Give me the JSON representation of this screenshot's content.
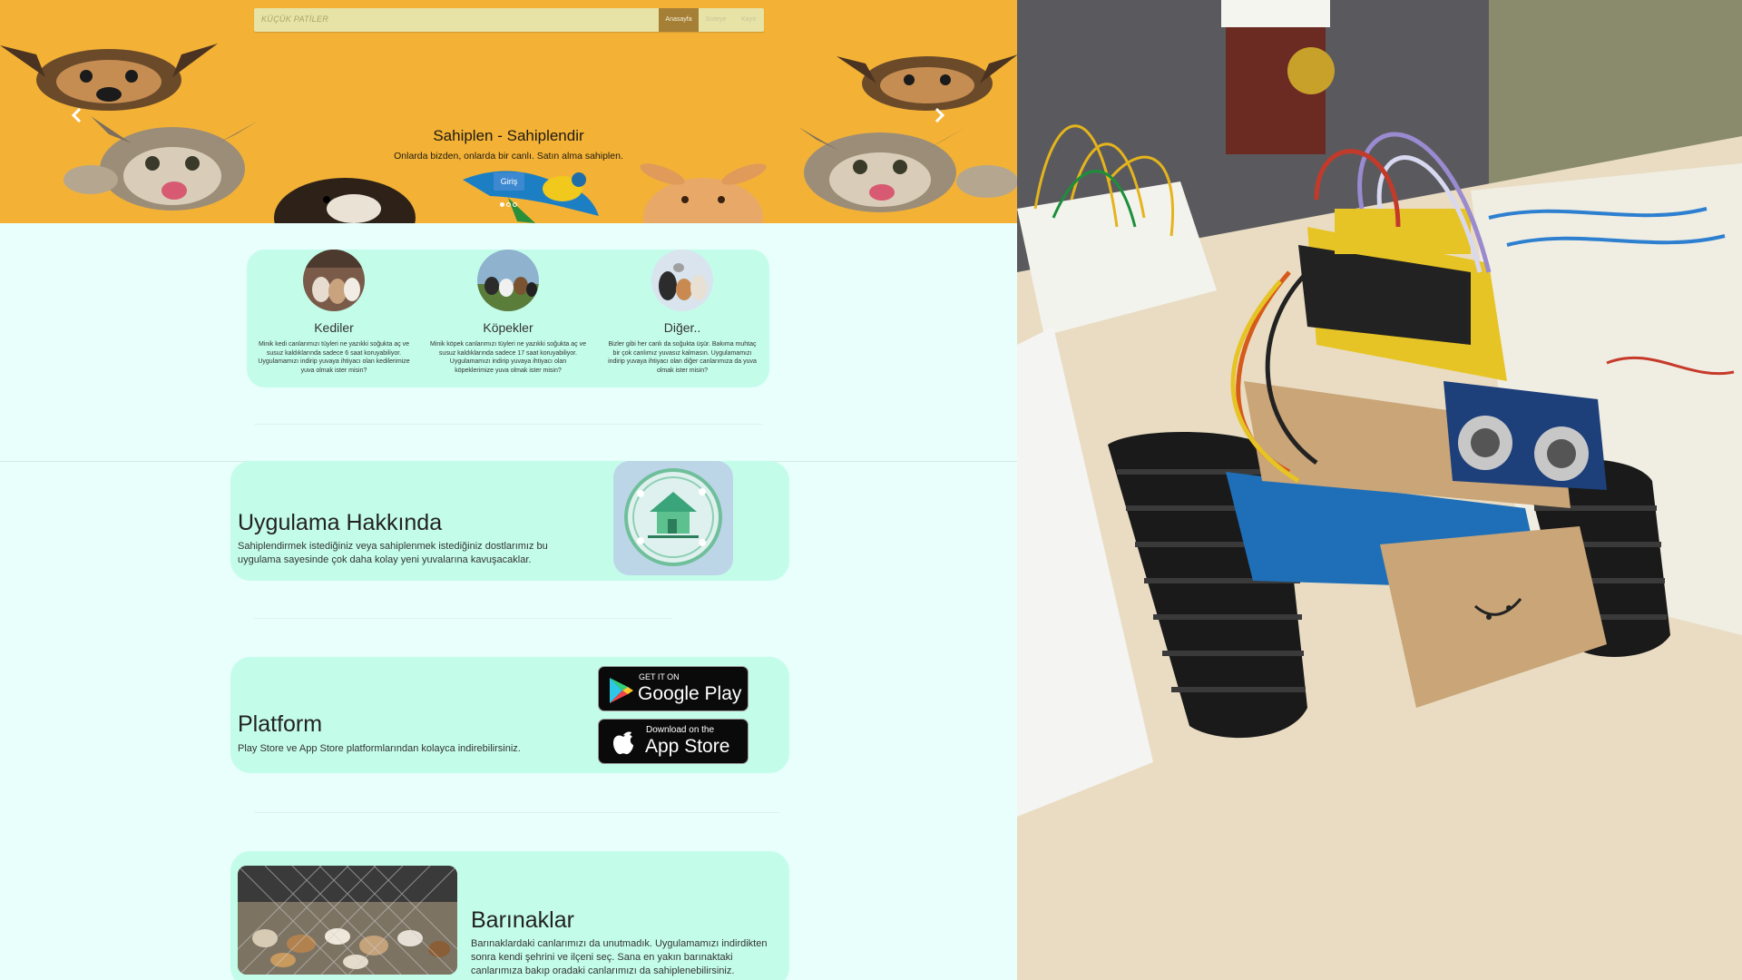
{
  "nav": {
    "brand": "KÜÇÜK PATİLER",
    "home": "Anasayfa",
    "login": "Sisteye",
    "exit": "Kayıt"
  },
  "hero": {
    "title": "Sahiplen - Sahiplendir",
    "subtitle": "Onlarda bizden, onlarda bir canlı. Satın alma sahiplen.",
    "button": "Giriş",
    "background_color": "#f3b236",
    "slides": 3,
    "active_slide": 1
  },
  "categories": [
    {
      "name": "Kediler",
      "text": "Minik kedi canlarımızı tüyleri ne yazıkki soğukta aç ve susuz kaldıklarında sadece 6 saat koruyabiliyor. Uygulamamızı indirip yuvaya ihtiyacı olan kedilerimize yuva olmak ister misin?"
    },
    {
      "name": "Köpekler",
      "text": "Minik köpek canlarımızı tüyleri ne yazıkki soğukta aç ve susuz kaldıklarında sadece 17 saat koruyabiliyor. Uygulamamızı indirip yuvaya ihtiyacı olan köpeklerimize yuva olmak ister misin?"
    },
    {
      "name": "Diğer..",
      "text": "Bizler gibi her canlı da soğukta üşür. Bakıma muhtaç bir çok canlımız yuvasız kalmasın. Uygulamamızı indirip yuvaya ihtiyacı olan diğer canlarımıza da yuva olmak ister misin?"
    }
  ],
  "about": {
    "title": "Uygulama Hakkında",
    "text": "Sahiplendirmek istediğiniz veya sahiplenmek istediğiniz dostlarımız bu uygulama sayesinde çok daha kolay yeni yuvalarına kavuşacaklar."
  },
  "platform": {
    "title": "Platform",
    "text": "Play Store ve App Store platformlarından kolayca indirebilirsiniz.",
    "google_play": {
      "small": "GET IT ON",
      "big": "Google Play"
    },
    "app_store": {
      "small": "Download on the",
      "big": "App Store"
    }
  },
  "shelters": {
    "title": "Barınaklar",
    "text": "Barınaklardaki canlarımızı da unutmadık. Uygulamamızı indirdikten sonra kendi şehrini ve ilçeni seç. Sana en yakın barınaktaki canlarımıza bakıp oradaki canlarımızı da sahiplenebilirsiniz."
  },
  "colors": {
    "page_bg": "#e8fffb",
    "card_bg": "#c4fcea",
    "nav_active": "#a67f37",
    "button_blue": "#3d89d1"
  }
}
